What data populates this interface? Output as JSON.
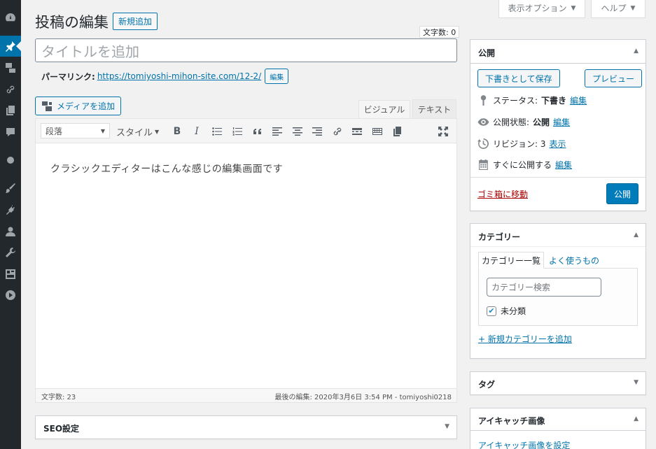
{
  "screen_meta": {
    "screen_options": "表示オプション",
    "help": "ヘルプ"
  },
  "header": {
    "title": "投稿の編集",
    "add_new": "新規追加"
  },
  "title_field": {
    "char_count": "文字数: 0",
    "placeholder": "タイトルを追加"
  },
  "permalink": {
    "label": "パーマリンク:",
    "url": "https://tomiyoshi-mihon-site.com/12-2/",
    "edit": "編集"
  },
  "media": {
    "add_media": "メディアを追加"
  },
  "editor_tabs": {
    "visual": "ビジュアル",
    "text": "テキスト"
  },
  "toolbar": {
    "format": "段落",
    "style": "スタイル",
    "icons": [
      "bold-icon",
      "italic-icon",
      "bullet-list-icon",
      "numbered-list-icon",
      "blockquote-icon",
      "align-left-icon",
      "align-center-icon",
      "align-right-icon",
      "link-icon",
      "read-more-icon",
      "toolbar-toggle-icon",
      "copy-icon",
      "fullscreen-icon"
    ]
  },
  "editor": {
    "content": "クラシックエディターはこんな感じの編集画面です",
    "word_count": "文字数: 23",
    "last_edited": "最後の編集: 2020年3月6日 3:54 PM - tomiyoshi0218"
  },
  "seo_box": {
    "title": "SEO設定"
  },
  "publish_box": {
    "title": "公開",
    "save_draft": "下書きとして保存",
    "preview": "プレビュー",
    "status_label": "ステータス:",
    "status_value": "下書き",
    "visibility_label": "公開状態:",
    "visibility_value": "公開",
    "revisions_label": "リビジョン: 3",
    "revisions_link": "表示",
    "schedule_label": "すぐに公開する",
    "edit_link": "編集",
    "trash": "ゴミ箱に移動",
    "publish": "公開"
  },
  "category_box": {
    "title": "カテゴリー",
    "tab_all": "カテゴリー一覧",
    "tab_popular": "よく使うもの",
    "search_placeholder": "カテゴリー検索",
    "items": [
      {
        "label": "未分類",
        "checked": true
      }
    ],
    "add_new": "+ 新規カテゴリーを追加"
  },
  "tag_box": {
    "title": "タグ"
  },
  "featured_box": {
    "title": "アイキャッチ画像",
    "set_link": "アイキャッチ画像を設定"
  },
  "colors": {
    "accent": "#0073aa",
    "primary_button": "#007cba",
    "sidebar": "#23282d",
    "trash": "#a00000"
  }
}
